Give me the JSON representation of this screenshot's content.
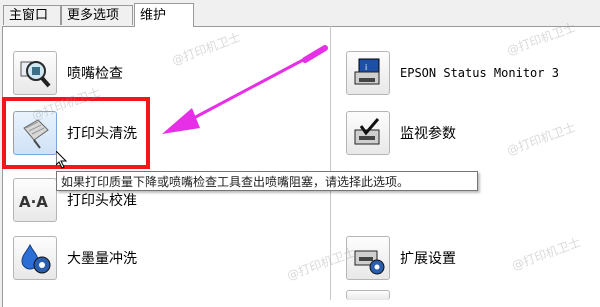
{
  "tabs": [
    {
      "label": "主窗口"
    },
    {
      "label": "更多选项"
    },
    {
      "label": "维护"
    }
  ],
  "left_items": [
    {
      "label": "喷嘴检查",
      "icon": "magnifier-printhead-icon"
    },
    {
      "label": "打印头清洗",
      "icon": "printhead-cleaning-icon"
    },
    {
      "label": "打印头校准",
      "icon": "print-head-alignment-icon"
    },
    {
      "label": "大墨量冲洗",
      "icon": "ink-flush-icon"
    }
  ],
  "right_items": [
    {
      "label": "EPSON Status Monitor 3",
      "icon": "status-monitor-icon"
    },
    {
      "label": "监视参数",
      "icon": "monitoring-preferences-icon"
    },
    {
      "label": "扩展设置",
      "icon": "extended-settings-icon"
    }
  ],
  "tooltip": "如果打印质量下降或喷嘴检查工具查出喷嘴阻塞，请选择此选项。",
  "watermark": "@打印机卫士",
  "colors": {
    "highlight": "#f2151a",
    "arrow": "#e62fe6"
  }
}
